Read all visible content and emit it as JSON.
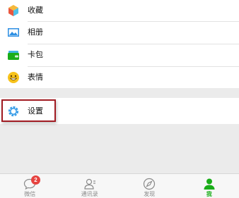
{
  "menu": {
    "favorites_label": "收藏",
    "album_label": "相册",
    "cards_label": "卡包",
    "stickers_label": "表情",
    "settings_label": "设置"
  },
  "tabbar": {
    "tabs": [
      {
        "label": "微信",
        "badge": "2"
      },
      {
        "label": "通讯录"
      },
      {
        "label": "发现"
      },
      {
        "label": "我",
        "active": true
      }
    ]
  },
  "colors": {
    "accent_green": "#1aad19",
    "badge_red": "#e64340",
    "highlight_border": "#a11b22"
  }
}
